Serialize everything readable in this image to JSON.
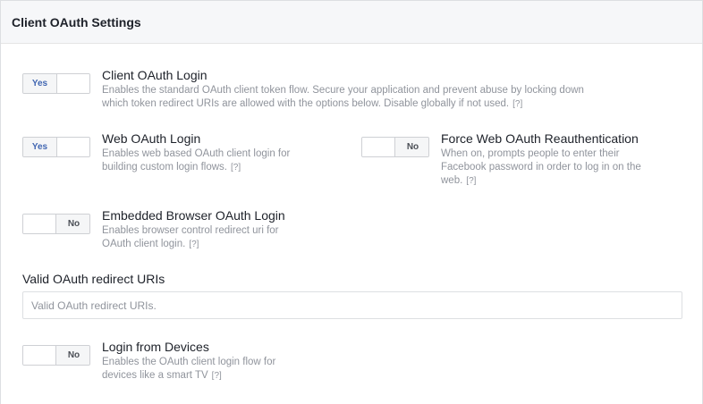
{
  "panel": {
    "title": "Client OAuth Settings"
  },
  "options": {
    "client_oauth_login": {
      "state": "Yes",
      "title": "Client OAuth Login",
      "desc_line1": "Enables the standard OAuth client token flow. Secure your application and prevent abuse by locking down",
      "desc_line2": "which token redirect URIs are allowed with the options below. Disable globally if not used.",
      "help": "[?]"
    },
    "web_oauth_login": {
      "state": "Yes",
      "title": "Web OAuth Login",
      "desc_line1": "Enables web based OAuth client login for",
      "desc_line2": "building custom login flows.",
      "help": "[?]"
    },
    "force_web_oauth_reauth": {
      "state": "No",
      "title": "Force Web OAuth Reauthentication",
      "desc_line1": "When on, prompts people to enter their",
      "desc_line2": "Facebook password in order to log in on the",
      "desc_line3": "web.",
      "help": "[?]"
    },
    "embedded_browser_oauth_login": {
      "state": "No",
      "title": "Embedded Browser OAuth Login",
      "desc_line1": "Enables browser control redirect uri for",
      "desc_line2": "OAuth client login.",
      "help": "[?]"
    },
    "login_from_devices": {
      "state": "No",
      "title": "Login from Devices",
      "desc_line1": "Enables the OAuth client login flow for",
      "desc_line2": "devices like a smart TV",
      "help": "[?]"
    }
  },
  "redirect_uris": {
    "label": "Valid OAuth redirect URIs",
    "value": "",
    "placeholder": "Valid OAuth redirect URIs."
  },
  "colors": {
    "accent": "#4267b2",
    "muted_text": "#90949c",
    "header_bg": "#f6f7f9"
  }
}
